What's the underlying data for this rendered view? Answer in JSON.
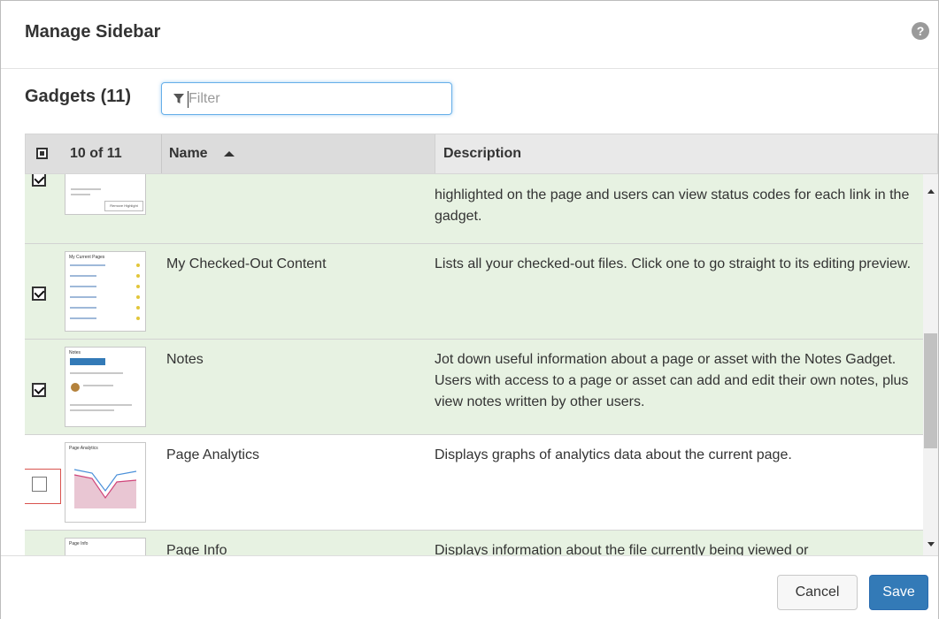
{
  "dialog": {
    "title": "Manage Sidebar",
    "help_icon": "question-circle-icon"
  },
  "gadgets": {
    "label": "Gadgets (11)",
    "filter_placeholder": "Filter",
    "filter_value": "",
    "filter_icon": "funnel-icon"
  },
  "table": {
    "selection_count": "10 of 11",
    "columns": {
      "name": "Name",
      "description": "Description"
    },
    "sort": "ascending",
    "rows": [
      {
        "name": "",
        "description": "highlighted on the page and users can view status codes for each link in the gadget.",
        "checked": true,
        "thumb_label": "Remove Highlight"
      },
      {
        "name": "My Checked-Out Content",
        "description": "Lists all your checked-out files. Click one to go straight to its editing preview.",
        "checked": true,
        "thumb_label": "My Current Pages"
      },
      {
        "name": "Notes",
        "description": "Jot down useful information about a page or asset with the Notes Gadget. Users with access to a page or asset can add and edit their own notes, plus view notes written by other users.",
        "checked": true,
        "thumb_label": "Notes"
      },
      {
        "name": "Page Analytics",
        "description": "Displays graphs of analytics data about the current page.",
        "checked": false,
        "thumb_label": "Page Analytics"
      },
      {
        "name": "Page Info",
        "description": "Displays information about the file currently being viewed or",
        "checked": true,
        "thumb_label": "Page Info"
      }
    ]
  },
  "footer": {
    "cancel_label": "Cancel",
    "save_label": "Save"
  },
  "colors": {
    "selected_row": "#e7f2e2",
    "primary": "#337ab7",
    "focus_outline": "#d9534f"
  }
}
